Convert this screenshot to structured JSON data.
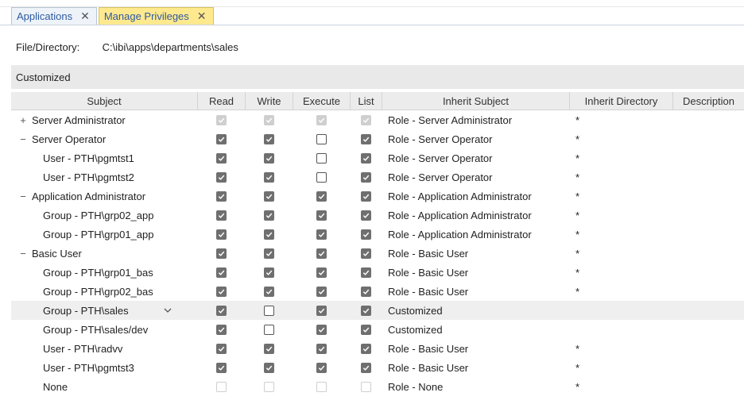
{
  "tabs": [
    {
      "label": "Applications",
      "active": false
    },
    {
      "label": "Manage Privileges",
      "active": true
    }
  ],
  "close_glyph": "✕",
  "file_directory": {
    "label": "File/Directory:",
    "value": "C:\\ibi\\apps\\departments\\sales"
  },
  "section_label": "Customized",
  "columns": {
    "subject": "Subject",
    "read": "Read",
    "write": "Write",
    "execute": "Execute",
    "list": "List",
    "inherit_subject": "Inherit Subject",
    "inherit_directory": "Inherit Directory",
    "description": "Description"
  },
  "rows": [
    {
      "subject": "Server Administrator",
      "level": 0,
      "toggle": "+",
      "read": true,
      "write": true,
      "execute": true,
      "list": true,
      "disabled": true,
      "inherit_subject": "Role - Server Administrator",
      "inherit_directory": "*",
      "description": ""
    },
    {
      "subject": "Server Operator",
      "level": 0,
      "toggle": "−",
      "read": true,
      "write": true,
      "execute": false,
      "list": true,
      "disabled": false,
      "inherit_subject": "Role - Server Operator",
      "inherit_directory": "*",
      "description": ""
    },
    {
      "subject": "User - PTH\\pgmtst1",
      "level": 1,
      "toggle": "",
      "read": true,
      "write": true,
      "execute": false,
      "list": true,
      "disabled": false,
      "inherit_subject": "Role - Server Operator",
      "inherit_directory": "*",
      "description": ""
    },
    {
      "subject": "User - PTH\\pgmtst2",
      "level": 1,
      "toggle": "",
      "read": true,
      "write": true,
      "execute": false,
      "list": true,
      "disabled": false,
      "inherit_subject": "Role - Server Operator",
      "inherit_directory": "*",
      "description": ""
    },
    {
      "subject": "Application Administrator",
      "level": 0,
      "toggle": "−",
      "read": true,
      "write": true,
      "execute": true,
      "list": true,
      "disabled": false,
      "inherit_subject": "Role - Application Administrator",
      "inherit_directory": "*",
      "description": ""
    },
    {
      "subject": "Group - PTH\\grp02_app",
      "level": 1,
      "toggle": "",
      "read": true,
      "write": true,
      "execute": true,
      "list": true,
      "disabled": false,
      "inherit_subject": "Role - Application Administrator",
      "inherit_directory": "*",
      "description": ""
    },
    {
      "subject": "Group - PTH\\grp01_app",
      "level": 1,
      "toggle": "",
      "read": true,
      "write": true,
      "execute": true,
      "list": true,
      "disabled": false,
      "inherit_subject": "Role - Application Administrator",
      "inherit_directory": "*",
      "description": ""
    },
    {
      "subject": "Basic User",
      "level": 0,
      "toggle": "−",
      "read": true,
      "write": true,
      "execute": true,
      "list": true,
      "disabled": false,
      "inherit_subject": "Role - Basic User",
      "inherit_directory": "*",
      "description": ""
    },
    {
      "subject": "Group - PTH\\grp01_bas",
      "level": 1,
      "toggle": "",
      "read": true,
      "write": true,
      "execute": true,
      "list": true,
      "disabled": false,
      "inherit_subject": "Role - Basic User",
      "inherit_directory": "*",
      "description": ""
    },
    {
      "subject": "Group - PTH\\grp02_bas",
      "level": 1,
      "toggle": "",
      "read": true,
      "write": true,
      "execute": true,
      "list": true,
      "disabled": false,
      "inherit_subject": "Role - Basic User",
      "inherit_directory": "*",
      "description": ""
    },
    {
      "subject": "Group - PTH\\sales",
      "level": 1,
      "toggle": "",
      "selected": true,
      "read": true,
      "write": false,
      "execute": true,
      "list": true,
      "disabled": false,
      "inherit_subject": "Customized",
      "inherit_directory": "",
      "description": ""
    },
    {
      "subject": "Group - PTH\\sales/dev",
      "level": 1,
      "toggle": "",
      "read": true,
      "write": false,
      "execute": true,
      "list": true,
      "disabled": false,
      "inherit_subject": "Customized",
      "inherit_directory": "",
      "description": ""
    },
    {
      "subject": "User - PTH\\radvv",
      "level": 1,
      "toggle": "",
      "read": true,
      "write": true,
      "execute": true,
      "list": true,
      "disabled": false,
      "inherit_subject": "Role - Basic User",
      "inherit_directory": "*",
      "description": ""
    },
    {
      "subject": "User - PTH\\pgmtst3",
      "level": 1,
      "toggle": "",
      "read": true,
      "write": true,
      "execute": true,
      "list": true,
      "disabled": false,
      "inherit_subject": "Role - Basic User",
      "inherit_directory": "*",
      "description": ""
    },
    {
      "subject": "None",
      "level": 1,
      "toggle": "",
      "read": false,
      "write": false,
      "execute": false,
      "list": false,
      "disabled": true,
      "inherit_subject": "Role - None",
      "inherit_directory": "*",
      "description": ""
    }
  ],
  "colors": {
    "active_tab": "#ffe98f",
    "checked": "#6f6f6f",
    "disabled": "#cfcfcf",
    "section_bar": "#e9e9e9"
  }
}
